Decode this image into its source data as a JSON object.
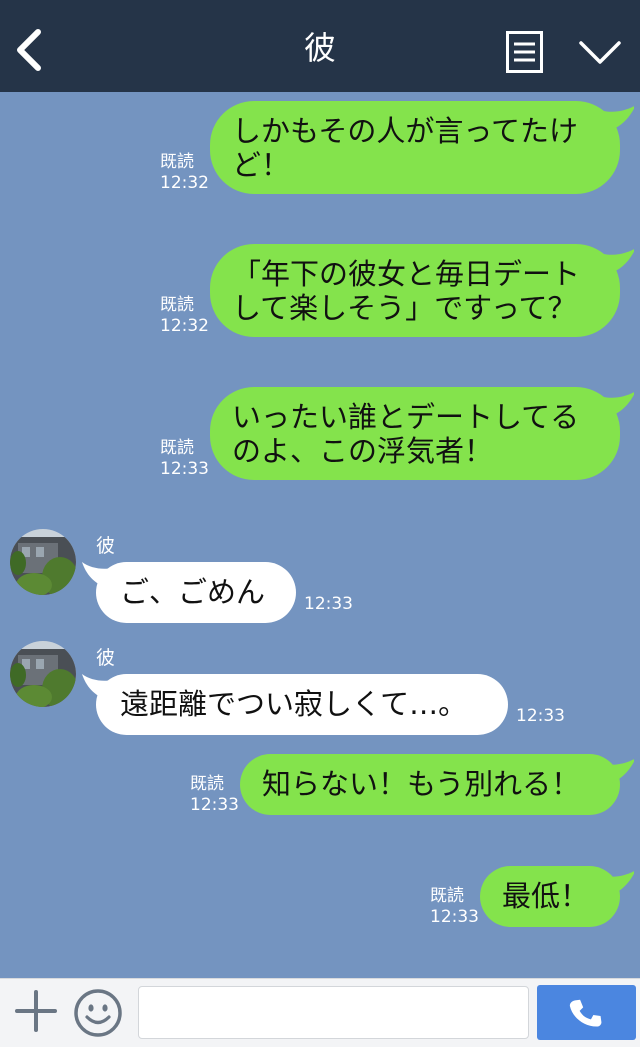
{
  "header": {
    "title": "彼",
    "back_icon": "chevron-left-icon",
    "menu_icon": "list-icon",
    "expand_icon": "chevron-down-icon"
  },
  "messages": [
    {
      "side": "out",
      "lines": [
        "しかもその人が言ってたけ",
        "ど！"
      ],
      "read": "既読",
      "time": "12:32"
    },
    {
      "side": "out",
      "lines": [
        "「年下の彼女と毎日デート",
        "して楽しそう」ですって？"
      ],
      "read": "既読",
      "time": "12:32"
    },
    {
      "side": "out",
      "lines": [
        "いったい誰とデートしてる",
        "のよ、この浮気者！"
      ],
      "read": "既読",
      "time": "12:33"
    },
    {
      "side": "in",
      "sender": "彼",
      "text": "ご、ごめん",
      "time": "12:33"
    },
    {
      "side": "in",
      "sender": "彼",
      "text": "遠距離でつい寂しくて…。",
      "time": "12:33"
    },
    {
      "side": "out",
      "lines": [
        "知らない！もう別れる！"
      ],
      "read": "既読",
      "time": "12:33"
    },
    {
      "side": "out",
      "lines": [
        "最低！"
      ],
      "read": "既読",
      "time": "12:33"
    }
  ],
  "input": {
    "value": "",
    "placeholder": "",
    "plus_icon": "plus-icon",
    "emoji_icon": "smiley-icon",
    "call_icon": "phone-icon"
  },
  "colors": {
    "header_bg": "#253448",
    "chat_bg": "#7494c0",
    "outgoing_bubble": "#84e34c",
    "incoming_bubble": "#ffffff",
    "call_button": "#4b86e0"
  }
}
